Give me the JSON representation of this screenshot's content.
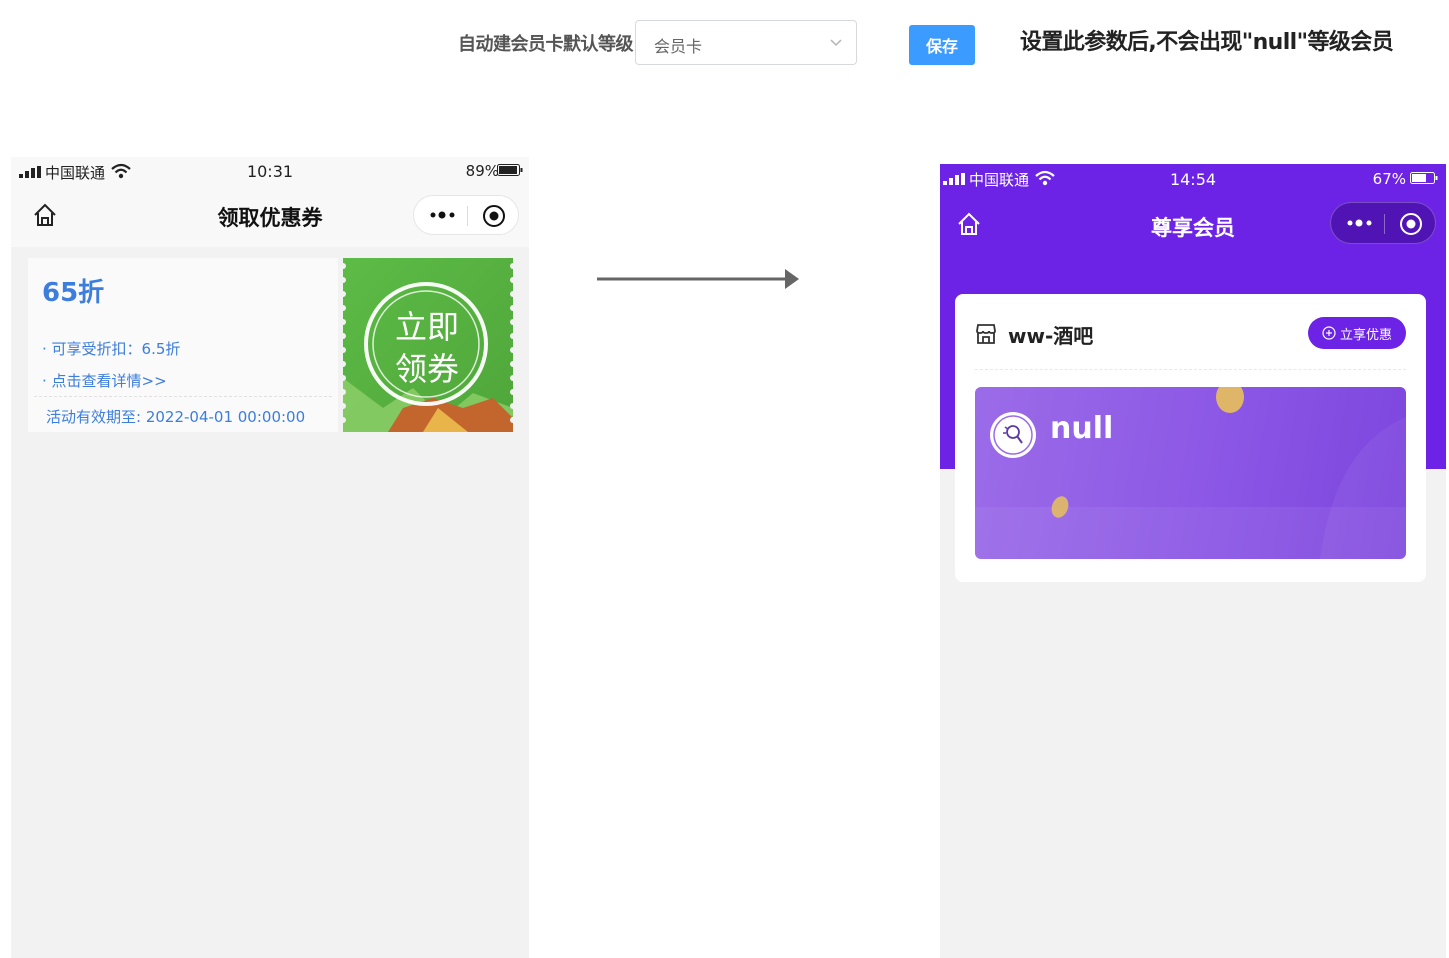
{
  "settings": {
    "label": "自动建会员卡默认等级",
    "select_value": "会员卡",
    "save_label": "保存",
    "note": "设置此参数后,不会出现\"null\"等级会员"
  },
  "phone_left": {
    "carrier": "中国联通",
    "time": "10:31",
    "battery": "89%",
    "title": "领取优惠券",
    "coupon": {
      "discount": "65折",
      "line1": "· 可享受折扣：6.5折",
      "line2": "· 点击查看详情>>",
      "validity": "活动有效期至: 2022-04-01 00:00:00",
      "stamp_line1": "立即",
      "stamp_line2": "领券"
    }
  },
  "phone_right": {
    "carrier": "中国联通",
    "time": "14:54",
    "battery": "67%",
    "title": "尊享会员",
    "shop_name": "ww-酒吧",
    "perk_button": "立享优惠",
    "member_level": "null"
  },
  "colors": {
    "primary_blue": "#3b9bff",
    "coupon_text": "#3d7ddc",
    "member_purple": "#6c23e5",
    "stub_green": "#5dbb46"
  }
}
